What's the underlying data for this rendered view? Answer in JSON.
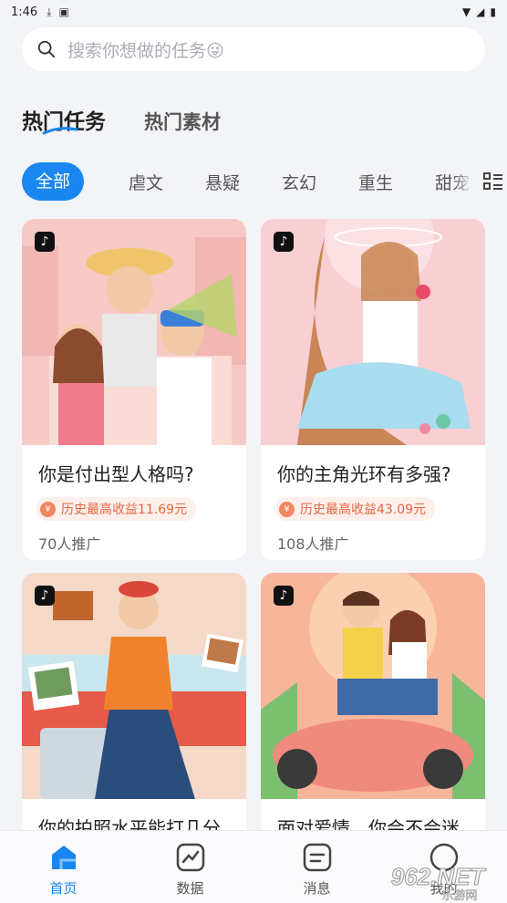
{
  "status_bar": {
    "time": "1:46"
  },
  "search": {
    "placeholder": "搜索你想做的任务😜"
  },
  "main_tabs": [
    {
      "label": "热门任务",
      "active": true
    },
    {
      "label": "热门素材",
      "active": false
    }
  ],
  "categories": [
    "全部",
    "虐文",
    "悬疑",
    "玄幻",
    "重生",
    "甜宠"
  ],
  "cards": [
    {
      "title": "你是付出型人格吗?",
      "earnings": "历史最高收益11.69元",
      "count": "70人推广",
      "coin": "¥",
      "platform_icon": "tiktok-icon"
    },
    {
      "title": "你的主角光环有多强?",
      "earnings": "历史最高收益43.09元",
      "count": "108人推广",
      "coin": "¥",
      "platform_icon": "tiktok-icon"
    },
    {
      "title": "你的拍照水平能打几分",
      "platform_icon": "tiktok-icon"
    },
    {
      "title": "面对爱情，你会不会迷",
      "platform_icon": "tiktok-icon"
    }
  ],
  "bottom_nav": [
    {
      "label": "首页",
      "icon": "home-icon",
      "active": true
    },
    {
      "label": "数据",
      "icon": "chart-icon",
      "active": false
    },
    {
      "label": "消息",
      "icon": "message-icon",
      "active": false
    },
    {
      "label": "我的",
      "icon": "profile-icon",
      "active": false
    }
  ],
  "watermark": {
    "text": "962.NET",
    "sub": "乐游网"
  },
  "colors": {
    "accent": "#1a86f0",
    "earn": "#e8663e",
    "background": "#f2f4f8"
  }
}
